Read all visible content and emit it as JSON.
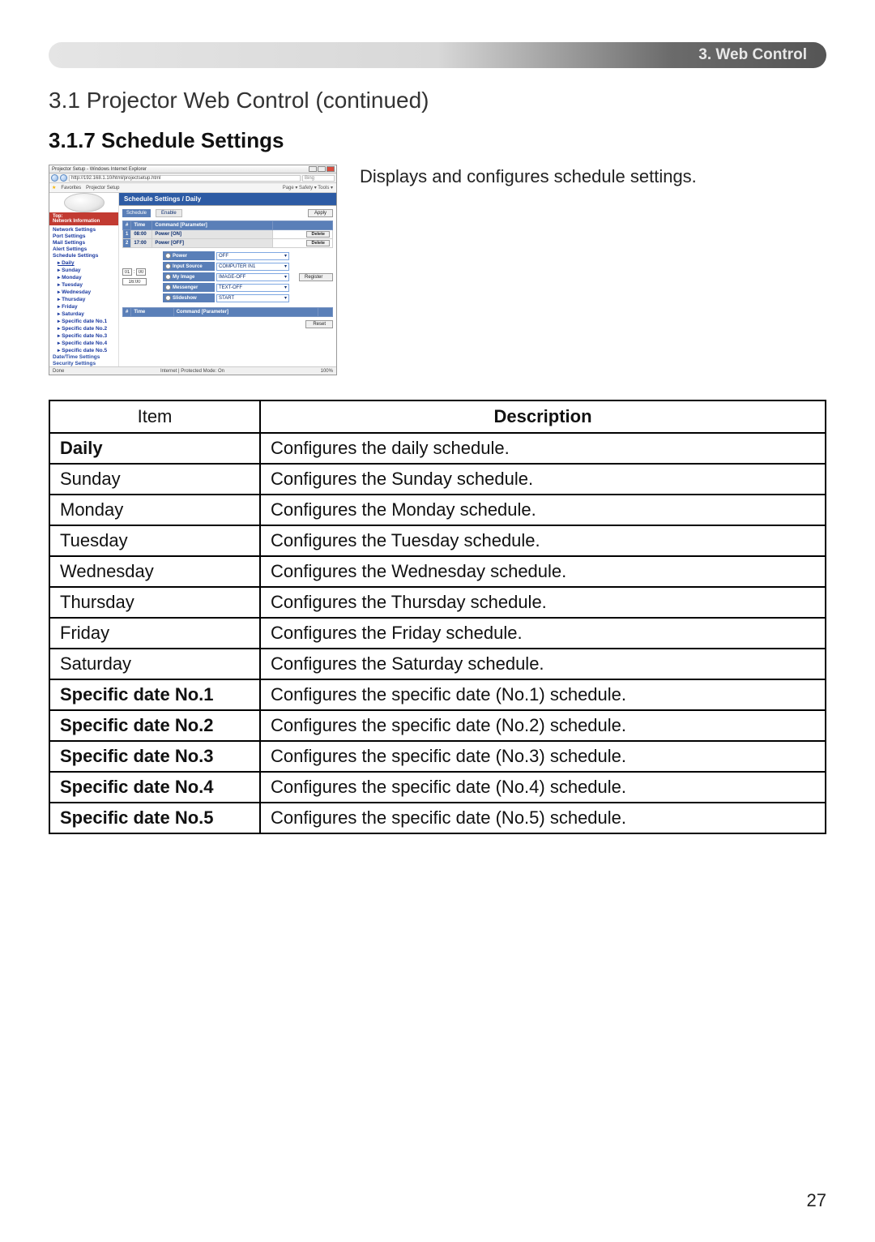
{
  "header": {
    "section": "3. Web Control"
  },
  "section_title": "3.1 Projector Web Control (continued)",
  "subsection_title": "3.1.7 Schedule Settings",
  "intro": "Displays and configures schedule settings.",
  "page_number": "27",
  "screenshot": {
    "window_title": "Projector Setup - Windows Internet Explorer",
    "url": "http://192.168.1.10/html/projectsetup.html",
    "search_hint": "Bing",
    "fav_label": "Favorites",
    "tab_label": "Projector Setup",
    "tools_right": "Page ▾  Safety ▾  Tools ▾",
    "sidebar": {
      "top_a": "Top:",
      "top_b": "Network Information",
      "items": [
        "Network Settings",
        "Port Settings",
        "Mail Settings",
        "Alert Settings",
        "Schedule Settings"
      ],
      "sched_children": [
        "Daily",
        "Sunday",
        "Monday",
        "Tuesday",
        "Wednesday",
        "Thursday",
        "Friday",
        "Saturday",
        "Specific date No.1",
        "Specific date No.2",
        "Specific date No.3",
        "Specific date No.4",
        "Specific date No.5"
      ],
      "tail": [
        "Date/Time Settings",
        "Security Settings"
      ]
    },
    "main": {
      "title": "Schedule Settings / Daily",
      "schedule_label": "Schedule",
      "enable_label": "Enable",
      "apply": "Apply",
      "th_num": "#",
      "th_time": "Time",
      "th_cmd": "Command [Parameter]",
      "rows": [
        {
          "n": "1",
          "time": "08:00",
          "cmd": "Power [ON]",
          "btn": "Delete"
        },
        {
          "n": "2",
          "time": "17:00",
          "cmd": "Power [OFF]",
          "btn": "Delete"
        }
      ],
      "time_hint_h": "01",
      "time_hint_m": "00",
      "time_big": "16:00",
      "params": [
        {
          "label": "Power",
          "sel": "OFF"
        },
        {
          "label": "Input Source",
          "sel": "COMPUTER IN1"
        },
        {
          "label": "My Image",
          "sel": "IMAGE-OFF"
        },
        {
          "label": "Messenger",
          "sel": "TEXT-OFF"
        },
        {
          "label": "Slideshow",
          "sel": "START"
        }
      ],
      "register": "Register",
      "reset": "Reset",
      "status_left": "Done",
      "status_mid": "Internet | Protected Mode: On",
      "status_right": "100%"
    }
  },
  "table": {
    "headers": {
      "item": "Item",
      "desc": "Description"
    },
    "rows": [
      {
        "item": "Daily",
        "bold": true,
        "desc": "Configures the daily schedule."
      },
      {
        "item": "Sunday",
        "bold": false,
        "desc": "Configures the Sunday schedule."
      },
      {
        "item": "Monday",
        "bold": false,
        "desc": "Configures the Monday schedule."
      },
      {
        "item": "Tuesday",
        "bold": false,
        "desc": "Configures the Tuesday schedule."
      },
      {
        "item": "Wednesday",
        "bold": false,
        "desc": "Configures the Wednesday schedule."
      },
      {
        "item": "Thursday",
        "bold": false,
        "desc": "Configures the Thursday schedule."
      },
      {
        "item": "Friday",
        "bold": false,
        "desc": "Configures the Friday schedule."
      },
      {
        "item": "Saturday",
        "bold": false,
        "desc": "Configures the Saturday schedule."
      },
      {
        "item": "Specific date No.1",
        "bold": true,
        "desc": "Configures the specific date (No.1) schedule."
      },
      {
        "item": "Specific date No.2",
        "bold": true,
        "desc": "Configures the specific date (No.2) schedule."
      },
      {
        "item": "Specific date No.3",
        "bold": true,
        "desc": "Configures the specific date (No.3) schedule."
      },
      {
        "item": "Specific date No.4",
        "bold": true,
        "desc": "Configures the specific date (No.4) schedule."
      },
      {
        "item": "Specific date No.5",
        "bold": true,
        "desc": "Configures the specific date (No.5) schedule."
      }
    ]
  }
}
